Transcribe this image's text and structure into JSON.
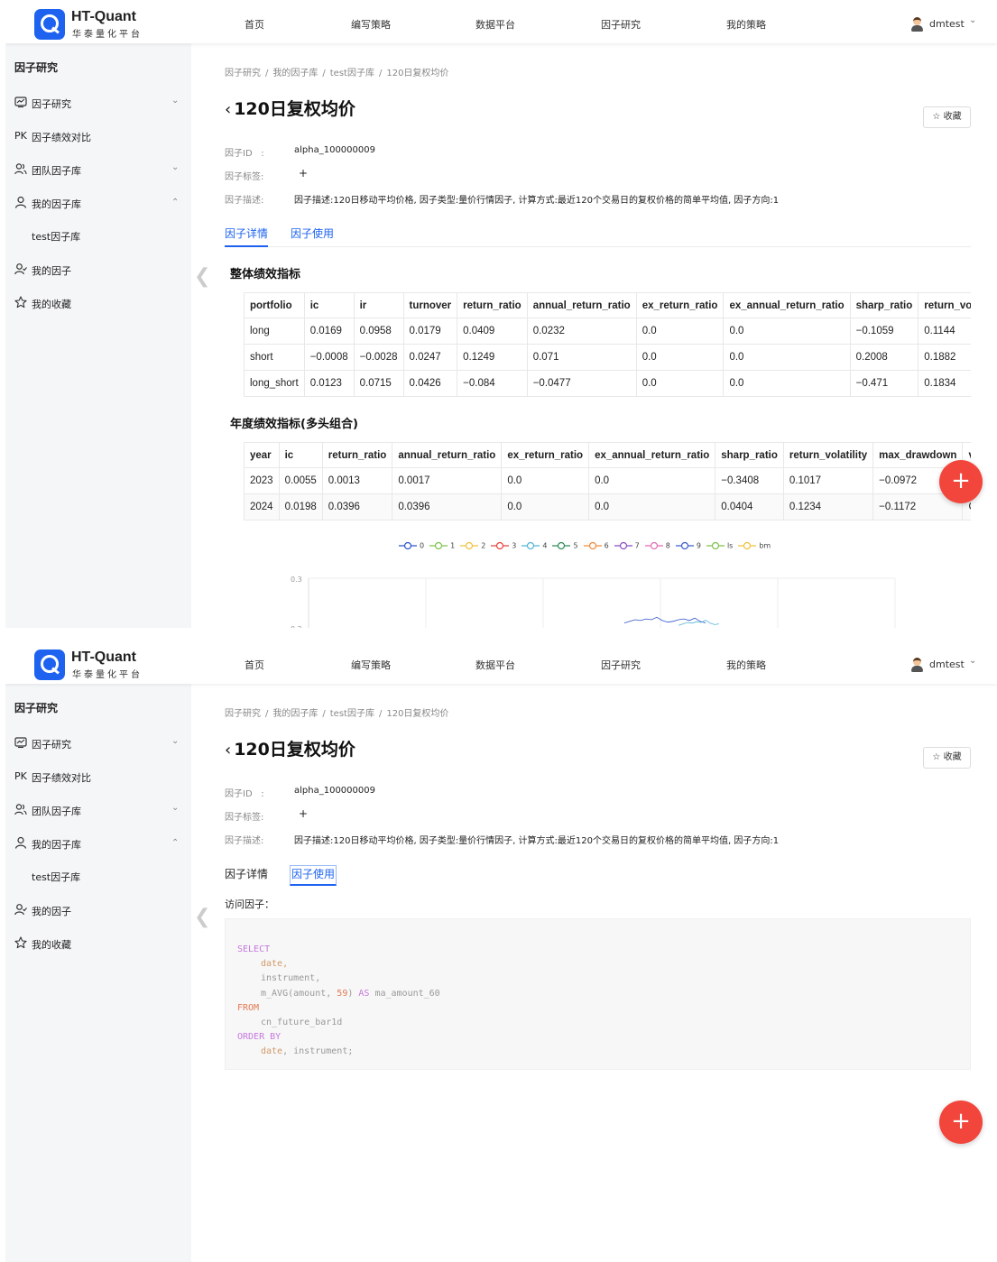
{
  "brand": {
    "title": "HT-Quant",
    "subtitle": "华泰量化平台"
  },
  "nav": {
    "items": [
      "首页",
      "编写策略",
      "数据平台",
      "因子研究",
      "我的策略"
    ],
    "user": "dmtest"
  },
  "sidebar": {
    "title": "因子研究",
    "items": [
      {
        "label": "因子研究",
        "icon": "chart-box-icon",
        "chevron": "down"
      },
      {
        "label": "因子绩效对比",
        "icon": "pk-icon",
        "chevron": ""
      },
      {
        "label": "团队因子库",
        "icon": "team-icon",
        "chevron": "down"
      },
      {
        "label": "我的因子库",
        "icon": "user-icon",
        "chevron": "up"
      },
      {
        "label": "test因子库",
        "icon": "",
        "chevron": ""
      },
      {
        "label": "我的因子",
        "icon": "user-check-icon",
        "chevron": ""
      },
      {
        "label": "我的收藏",
        "icon": "star-icon",
        "chevron": ""
      }
    ],
    "pk_text": "PK"
  },
  "breadcrumb": [
    "因子研究",
    "我的因子库",
    "test因子库",
    "120日复权均价"
  ],
  "page": {
    "title": "120日复权均价",
    "favorite_label": "收藏",
    "factor_id_label": "因子ID",
    "factor_id_sep": ":",
    "factor_id": "alpha_100000009",
    "tag_label": "因子标签:",
    "tag_add": "+",
    "desc_label": "因子描述:",
    "desc": "因子描述:120日移动平均价格, 因子类型:量价行情因子, 计算方式:最近120个交易日的复权价格的简单平均值, 因子方向:1",
    "tabs": [
      "因子详情",
      "因子使用"
    ]
  },
  "overall": {
    "title": "整体绩效指标",
    "columns": [
      "portfolio",
      "ic",
      "ir",
      "turnover",
      "return_ratio",
      "annual_return_ratio",
      "ex_return_ratio",
      "ex_annual_return_ratio",
      "sharp_ratio",
      "return_vo"
    ],
    "rows": [
      [
        "long",
        "0.0169",
        "0.0958",
        "0.0179",
        "0.0409",
        "0.0232",
        "0.0",
        "0.0",
        "−0.1059",
        "0.1144"
      ],
      [
        "short",
        "−0.0008",
        "−0.0028",
        "0.0247",
        "0.1249",
        "0.071",
        "0.0",
        "0.0",
        "0.2008",
        "0.1882"
      ],
      [
        "long_short",
        "0.0123",
        "0.0715",
        "0.0426",
        "−0.084",
        "−0.0477",
        "0.0",
        "0.0",
        "−0.471",
        "0.1834"
      ]
    ]
  },
  "yearly": {
    "title": "年度绩效指标(多头组合)",
    "columns": [
      "year",
      "ic",
      "return_ratio",
      "annual_return_ratio",
      "ex_return_ratio",
      "ex_annual_return_ratio",
      "sharp_ratio",
      "return_volatility",
      "max_drawdown",
      "v"
    ],
    "rows": [
      [
        "2023",
        "0.0055",
        "0.0013",
        "0.0017",
        "0.0",
        "0.0",
        "−0.3408",
        "0.1017",
        "−0.0972",
        ""
      ],
      [
        "2024",
        "0.0198",
        "0.0396",
        "0.0396",
        "0.0",
        "0.0",
        "0.0404",
        "0.1234",
        "−0.1172",
        "C"
      ]
    ]
  },
  "chart_data": {
    "type": "line",
    "series": [
      {
        "name": "0",
        "color": "#2f54c9"
      },
      {
        "name": "1",
        "color": "#7cc24a"
      },
      {
        "name": "2",
        "color": "#f0c23c"
      },
      {
        "name": "3",
        "color": "#e8453c"
      },
      {
        "name": "4",
        "color": "#52b4d8"
      },
      {
        "name": "5",
        "color": "#2e8b57"
      },
      {
        "name": "6",
        "color": "#f08a3c"
      },
      {
        "name": "7",
        "color": "#8a4bc4"
      },
      {
        "name": "8",
        "color": "#e56bb8"
      },
      {
        "name": "9",
        "color": "#3a5fc9"
      },
      {
        "name": "ls",
        "color": "#7cc24a"
      },
      {
        "name": "bm",
        "color": "#f0c23c"
      }
    ],
    "y_ticks": [
      "0.3",
      "0.2"
    ],
    "sample_line": [
      0.06,
      0.08,
      0.1,
      0.09,
      0.11,
      0.1,
      0.13,
      0.09,
      0.07,
      0.08,
      0.1,
      0.11,
      0.09,
      0.12,
      0.08,
      0.06
    ]
  },
  "usage": {
    "visit_label": "访问因子：",
    "code": [
      {
        "t": "SELECT",
        "c": "kw",
        "indent": 0
      },
      {
        "t": "date,",
        "c": "fn",
        "indent": 1
      },
      {
        "t": "instrument,",
        "c": "id",
        "indent": 1
      },
      {
        "t": "m_AVG(amount, 59) AS ma_amount_60",
        "c": "mix",
        "indent": 1
      },
      {
        "t": "FROM",
        "c": "nm",
        "indent": 0
      },
      {
        "t": "cn_future_bar1d",
        "c": "id",
        "indent": 1
      },
      {
        "t": "ORDER BY",
        "c": "kw",
        "indent": 0
      },
      {
        "t": "date, instrument;",
        "c": "fn",
        "indent": 1
      }
    ]
  },
  "fab_label": "+"
}
